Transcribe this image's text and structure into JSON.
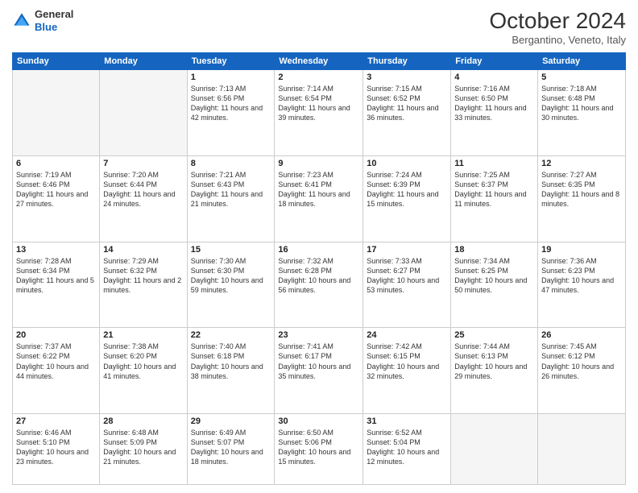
{
  "header": {
    "logo_general": "General",
    "logo_blue": "Blue",
    "month": "October 2024",
    "location": "Bergantino, Veneto, Italy"
  },
  "days_of_week": [
    "Sunday",
    "Monday",
    "Tuesday",
    "Wednesday",
    "Thursday",
    "Friday",
    "Saturday"
  ],
  "weeks": [
    [
      {
        "day": "",
        "sunrise": "",
        "sunset": "",
        "daylight": "",
        "empty": true
      },
      {
        "day": "",
        "sunrise": "",
        "sunset": "",
        "daylight": "",
        "empty": true
      },
      {
        "day": "1",
        "sunrise": "Sunrise: 7:13 AM",
        "sunset": "Sunset: 6:56 PM",
        "daylight": "Daylight: 11 hours and 42 minutes."
      },
      {
        "day": "2",
        "sunrise": "Sunrise: 7:14 AM",
        "sunset": "Sunset: 6:54 PM",
        "daylight": "Daylight: 11 hours and 39 minutes."
      },
      {
        "day": "3",
        "sunrise": "Sunrise: 7:15 AM",
        "sunset": "Sunset: 6:52 PM",
        "daylight": "Daylight: 11 hours and 36 minutes."
      },
      {
        "day": "4",
        "sunrise": "Sunrise: 7:16 AM",
        "sunset": "Sunset: 6:50 PM",
        "daylight": "Daylight: 11 hours and 33 minutes."
      },
      {
        "day": "5",
        "sunrise": "Sunrise: 7:18 AM",
        "sunset": "Sunset: 6:48 PM",
        "daylight": "Daylight: 11 hours and 30 minutes."
      }
    ],
    [
      {
        "day": "6",
        "sunrise": "Sunrise: 7:19 AM",
        "sunset": "Sunset: 6:46 PM",
        "daylight": "Daylight: 11 hours and 27 minutes."
      },
      {
        "day": "7",
        "sunrise": "Sunrise: 7:20 AM",
        "sunset": "Sunset: 6:44 PM",
        "daylight": "Daylight: 11 hours and 24 minutes."
      },
      {
        "day": "8",
        "sunrise": "Sunrise: 7:21 AM",
        "sunset": "Sunset: 6:43 PM",
        "daylight": "Daylight: 11 hours and 21 minutes."
      },
      {
        "day": "9",
        "sunrise": "Sunrise: 7:23 AM",
        "sunset": "Sunset: 6:41 PM",
        "daylight": "Daylight: 11 hours and 18 minutes."
      },
      {
        "day": "10",
        "sunrise": "Sunrise: 7:24 AM",
        "sunset": "Sunset: 6:39 PM",
        "daylight": "Daylight: 11 hours and 15 minutes."
      },
      {
        "day": "11",
        "sunrise": "Sunrise: 7:25 AM",
        "sunset": "Sunset: 6:37 PM",
        "daylight": "Daylight: 11 hours and 11 minutes."
      },
      {
        "day": "12",
        "sunrise": "Sunrise: 7:27 AM",
        "sunset": "Sunset: 6:35 PM",
        "daylight": "Daylight: 11 hours and 8 minutes."
      }
    ],
    [
      {
        "day": "13",
        "sunrise": "Sunrise: 7:28 AM",
        "sunset": "Sunset: 6:34 PM",
        "daylight": "Daylight: 11 hours and 5 minutes."
      },
      {
        "day": "14",
        "sunrise": "Sunrise: 7:29 AM",
        "sunset": "Sunset: 6:32 PM",
        "daylight": "Daylight: 11 hours and 2 minutes."
      },
      {
        "day": "15",
        "sunrise": "Sunrise: 7:30 AM",
        "sunset": "Sunset: 6:30 PM",
        "daylight": "Daylight: 10 hours and 59 minutes."
      },
      {
        "day": "16",
        "sunrise": "Sunrise: 7:32 AM",
        "sunset": "Sunset: 6:28 PM",
        "daylight": "Daylight: 10 hours and 56 minutes."
      },
      {
        "day": "17",
        "sunrise": "Sunrise: 7:33 AM",
        "sunset": "Sunset: 6:27 PM",
        "daylight": "Daylight: 10 hours and 53 minutes."
      },
      {
        "day": "18",
        "sunrise": "Sunrise: 7:34 AM",
        "sunset": "Sunset: 6:25 PM",
        "daylight": "Daylight: 10 hours and 50 minutes."
      },
      {
        "day": "19",
        "sunrise": "Sunrise: 7:36 AM",
        "sunset": "Sunset: 6:23 PM",
        "daylight": "Daylight: 10 hours and 47 minutes."
      }
    ],
    [
      {
        "day": "20",
        "sunrise": "Sunrise: 7:37 AM",
        "sunset": "Sunset: 6:22 PM",
        "daylight": "Daylight: 10 hours and 44 minutes."
      },
      {
        "day": "21",
        "sunrise": "Sunrise: 7:38 AM",
        "sunset": "Sunset: 6:20 PM",
        "daylight": "Daylight: 10 hours and 41 minutes."
      },
      {
        "day": "22",
        "sunrise": "Sunrise: 7:40 AM",
        "sunset": "Sunset: 6:18 PM",
        "daylight": "Daylight: 10 hours and 38 minutes."
      },
      {
        "day": "23",
        "sunrise": "Sunrise: 7:41 AM",
        "sunset": "Sunset: 6:17 PM",
        "daylight": "Daylight: 10 hours and 35 minutes."
      },
      {
        "day": "24",
        "sunrise": "Sunrise: 7:42 AM",
        "sunset": "Sunset: 6:15 PM",
        "daylight": "Daylight: 10 hours and 32 minutes."
      },
      {
        "day": "25",
        "sunrise": "Sunrise: 7:44 AM",
        "sunset": "Sunset: 6:13 PM",
        "daylight": "Daylight: 10 hours and 29 minutes."
      },
      {
        "day": "26",
        "sunrise": "Sunrise: 7:45 AM",
        "sunset": "Sunset: 6:12 PM",
        "daylight": "Daylight: 10 hours and 26 minutes."
      }
    ],
    [
      {
        "day": "27",
        "sunrise": "Sunrise: 6:46 AM",
        "sunset": "Sunset: 5:10 PM",
        "daylight": "Daylight: 10 hours and 23 minutes."
      },
      {
        "day": "28",
        "sunrise": "Sunrise: 6:48 AM",
        "sunset": "Sunset: 5:09 PM",
        "daylight": "Daylight: 10 hours and 21 minutes."
      },
      {
        "day": "29",
        "sunrise": "Sunrise: 6:49 AM",
        "sunset": "Sunset: 5:07 PM",
        "daylight": "Daylight: 10 hours and 18 minutes."
      },
      {
        "day": "30",
        "sunrise": "Sunrise: 6:50 AM",
        "sunset": "Sunset: 5:06 PM",
        "daylight": "Daylight: 10 hours and 15 minutes."
      },
      {
        "day": "31",
        "sunrise": "Sunrise: 6:52 AM",
        "sunset": "Sunset: 5:04 PM",
        "daylight": "Daylight: 10 hours and 12 minutes."
      },
      {
        "day": "",
        "sunrise": "",
        "sunset": "",
        "daylight": "",
        "empty": true
      },
      {
        "day": "",
        "sunrise": "",
        "sunset": "",
        "daylight": "",
        "empty": true
      }
    ]
  ]
}
